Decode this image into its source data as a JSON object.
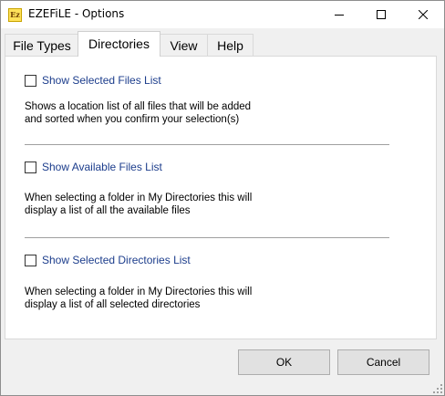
{
  "window": {
    "title": "EZEFiLE - Options",
    "app_icon_text": "Ez"
  },
  "tabs": [
    {
      "label": "File Types",
      "selected": false
    },
    {
      "label": "Directories",
      "selected": true
    },
    {
      "label": "View",
      "selected": false
    },
    {
      "label": "Help",
      "selected": false
    }
  ],
  "options": [
    {
      "label": "Show Selected Files List",
      "checked": false,
      "description_line1": "Shows a location list of all files that will be added",
      "description_line2": "and sorted when you confirm your selection(s)"
    },
    {
      "label": "Show Available Files List",
      "checked": false,
      "description_line1": "When selecting a folder in My Directories this will",
      "description_line2": "display a list of all the available files"
    },
    {
      "label": "Show Selected Directories List",
      "checked": false,
      "description_line1": "When selecting a folder in My Directories this will",
      "description_line2": "display a list of all selected directories"
    }
  ],
  "buttons": {
    "ok": "OK",
    "cancel": "Cancel"
  },
  "icons": {
    "minimize": "minimize-icon",
    "maximize": "maximize-icon",
    "close": "close-icon",
    "resize_grip": "resize-grip-icon"
  },
  "colors": {
    "checkbox_label": "#1c3d8c",
    "tab_selected_bg": "#ffffff",
    "window_bg": "#f0f0f0"
  }
}
